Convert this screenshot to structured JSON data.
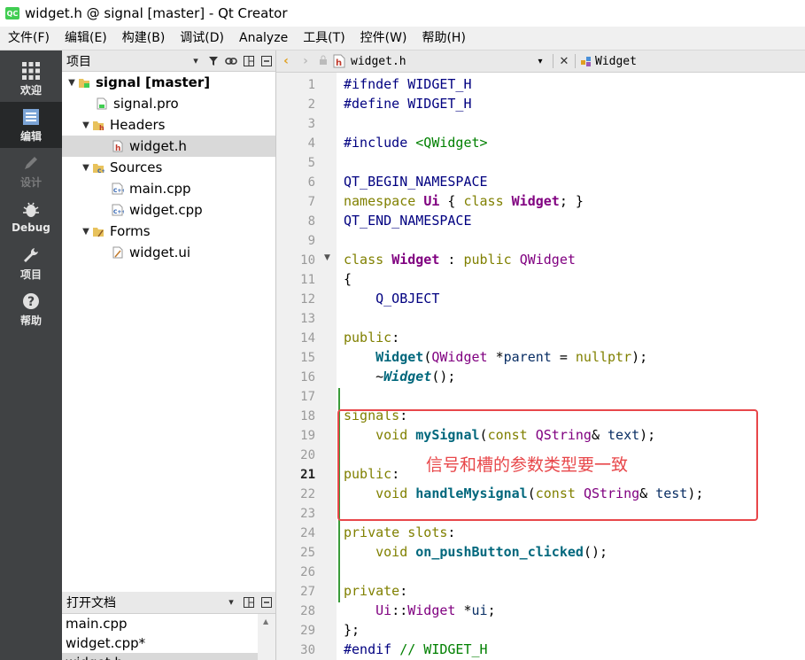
{
  "window": {
    "title": "widget.h @ signal [master] - Qt Creator",
    "app_icon": "QC"
  },
  "menu": [
    "文件(F)",
    "编辑(E)",
    "构建(B)",
    "调试(D)",
    "Analyze",
    "工具(T)",
    "控件(W)",
    "帮助(H)"
  ],
  "modes": [
    {
      "label": "欢迎",
      "icon": "grid-icon"
    },
    {
      "label": "编辑",
      "icon": "edit-document-icon"
    },
    {
      "label": "设计",
      "icon": "pencil-icon"
    },
    {
      "label": "Debug",
      "icon": "bug-icon"
    },
    {
      "label": "项目",
      "icon": "wrench-icon"
    },
    {
      "label": "帮助",
      "icon": "help-icon"
    }
  ],
  "project_pane": {
    "title": "项目",
    "tree": [
      {
        "label": "signal [master]",
        "bold": true
      },
      {
        "label": "signal.pro"
      },
      {
        "label": "Headers"
      },
      {
        "label": "widget.h",
        "selected": true
      },
      {
        "label": "Sources"
      },
      {
        "label": "main.cpp"
      },
      {
        "label": "widget.cpp"
      },
      {
        "label": "Forms"
      },
      {
        "label": "widget.ui"
      }
    ]
  },
  "open_docs": {
    "title": "打开文档",
    "items": [
      "main.cpp",
      "widget.cpp*",
      "widget.h"
    ]
  },
  "editor_toolbar": {
    "file": "widget.h",
    "symbol": "Widget"
  },
  "editor": {
    "current_line": 21,
    "line_numbers": [
      "1",
      "2",
      "3",
      "4",
      "5",
      "6",
      "7",
      "8",
      "9",
      "10",
      "11",
      "12",
      "13",
      "14",
      "15",
      "16",
      "17",
      "18",
      "19",
      "20",
      "21",
      "22",
      "23",
      "24",
      "25",
      "26",
      "27",
      "28",
      "29",
      "30"
    ],
    "lines": {
      "l1": {
        "a": "#ifndef ",
        "b": "WIDGET_H"
      },
      "l2": {
        "a": "#define ",
        "b": "WIDGET_H"
      },
      "l4": {
        "a": "#include ",
        "b": "<QWidget>"
      },
      "l6": {
        "a": "QT_BEGIN_NAMESPACE"
      },
      "l7": {
        "a": "namespace ",
        "b": "Ui",
        "c": " { ",
        "d": "class ",
        "e": "Widget",
        "f": "; }"
      },
      "l8": {
        "a": "QT_END_NAMESPACE"
      },
      "l10": {
        "a": "class ",
        "b": "Widget",
        "c": " : ",
        "d": "public ",
        "e": "QWidget"
      },
      "l11": {
        "a": "{"
      },
      "l12": {
        "a": "    ",
        "b": "Q_OBJECT"
      },
      "l14": {
        "a": "public",
        "b": ":"
      },
      "l15": {
        "a": "    ",
        "b": "Widget",
        "c": "(",
        "d": "QWidget",
        "e": " *",
        "f": "parent",
        "g": " = ",
        "h": "nullptr",
        "i": ");"
      },
      "l16": {
        "a": "    ~",
        "b": "Widget",
        "c": "();"
      },
      "l18": {
        "a": "signals",
        "b": ":"
      },
      "l19": {
        "a": "    ",
        "b": "void ",
        "c": "mySignal",
        "d": "(",
        "e": "const ",
        "f": "QString",
        "g": "& ",
        "h": "text",
        "i": ");"
      },
      "l21": {
        "a": "public",
        "b": ":"
      },
      "l22": {
        "a": "    ",
        "b": "void ",
        "c": "handleMysignal",
        "d": "(",
        "e": "const ",
        "f": "QString",
        "g": "& ",
        "h": "test",
        "i": ");"
      },
      "l24": {
        "a": "private ",
        "b": "slots",
        "c": ":"
      },
      "l25": {
        "a": "    ",
        "b": "void ",
        "c": "on_pushButton_clicked",
        "d": "();"
      },
      "l27": {
        "a": "private",
        "b": ":"
      },
      "l28": {
        "a": "    ",
        "b": "Ui",
        "c": "::",
        "d": "Widget",
        "e": " *",
        "f": "ui",
        "g": ";"
      },
      "l29": {
        "a": "};"
      },
      "l30": {
        "a": "#endif ",
        "b": "// WIDGET_H"
      }
    }
  },
  "annotation": {
    "text": "信号和槽的参数类型要一致",
    "color": "#e8474a"
  }
}
